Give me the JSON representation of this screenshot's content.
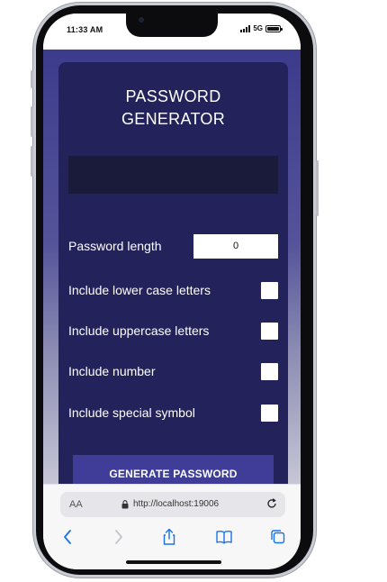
{
  "status_bar": {
    "time": "11:33 AM",
    "network": "5G"
  },
  "app": {
    "title_line1": "PASSWORD",
    "title_line2": "GENERATOR",
    "password_output": "",
    "length_label": "Password length",
    "length_value": "0",
    "options": [
      {
        "label": "Include lower case letters",
        "checked": false
      },
      {
        "label": "Include uppercase letters",
        "checked": false
      },
      {
        "label": "Include number",
        "checked": false
      },
      {
        "label": "Include special symbol",
        "checked": false
      }
    ],
    "generate_label": "GENERATE PASSWORD"
  },
  "browser": {
    "aa_label": "AA",
    "url": "http://localhost:19006",
    "icons": [
      "back-icon",
      "forward-icon",
      "share-icon",
      "bookmarks-icon",
      "tabs-icon",
      "reload-icon",
      "lock-icon"
    ]
  },
  "colors": {
    "card_bg": "#23225a",
    "button_bg": "#3f3d97",
    "page_gradient_top": "#3c3b8c",
    "ios_blue": "#1a73e8"
  }
}
